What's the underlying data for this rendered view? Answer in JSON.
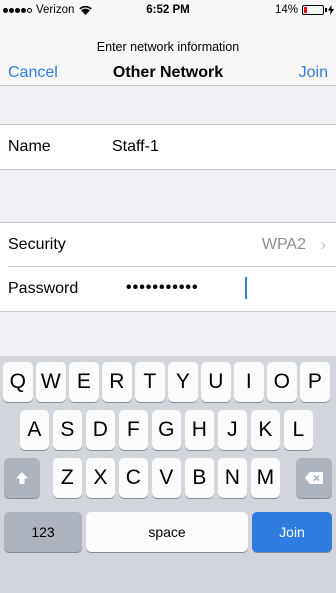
{
  "status_bar": {
    "carrier": "Verizon",
    "time": "6:52 PM",
    "battery": "14%",
    "battery_level": 0.14,
    "icons": [
      "signal-dots-icon",
      "wifi-icon",
      "battery-icon",
      "charging-bolt-icon"
    ]
  },
  "nav": {
    "prompt": "Enter network information",
    "cancel_label": "Cancel",
    "title": "Other Network",
    "join_label": "Join"
  },
  "form": {
    "name_label": "Name",
    "name_value": "Staff-1",
    "security_label": "Security",
    "security_value": "WPA2",
    "password_label": "Password",
    "password_value": "•••••••••••"
  },
  "keyboard": {
    "row1": [
      "Q",
      "W",
      "E",
      "R",
      "T",
      "Y",
      "U",
      "I",
      "O",
      "P"
    ],
    "row2": [
      "A",
      "S",
      "D",
      "F",
      "G",
      "H",
      "J",
      "K",
      "L"
    ],
    "row3": [
      "Z",
      "X",
      "C",
      "V",
      "B",
      "N",
      "M"
    ],
    "numbers_label": "123",
    "space_label": "space",
    "join_label": "Join",
    "accent_color": "#2f7de1"
  }
}
